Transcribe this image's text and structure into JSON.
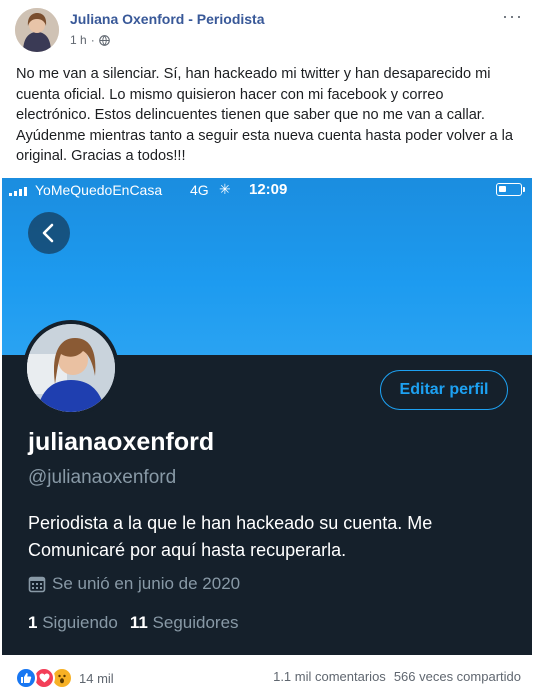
{
  "post": {
    "author": "Juliana Oxenford - Periodista",
    "time": "1 h",
    "separator": "·",
    "text": "No me van a silenciar. Sí, han hackeado mi twitter y han desaparecido mi cuenta oficial. Lo mismo quisieron hacer con mi facebook y correo electrónico. Estos delincuentes tienen que saber que no me van a callar. Ayúdenme mientras tanto a seguir esta nueva cuenta hasta poder volver a la original. Gracias a todos!!!",
    "more_icon": "···"
  },
  "phone": {
    "carrier": "YoMeQuedoEnCasa",
    "network": "4G",
    "spinner": "✳",
    "time": "12:09",
    "battery_level": 0.35
  },
  "profile": {
    "display_name": "julianaoxenford",
    "handle": "@julianaoxenford",
    "edit_button": "Editar perfil",
    "bio": "Periodista a la que le han hackeado su cuenta. Me Comunicaré por aquí hasta recuperarla.",
    "joined": "Se unió en junio de 2020",
    "following_count": "1",
    "following_label": "Siguiendo",
    "followers_count": "11",
    "followers_label": "Seguidores"
  },
  "footer": {
    "reactions_count": "14 mil",
    "comments": "1.1 mil comentarios",
    "shares": "566 veces compartido"
  },
  "colors": {
    "fb_link": "#385898",
    "twitter_blue": "#1da1f2",
    "twitter_dark_bg": "#15202b",
    "twitter_secondary": "#8899a6"
  }
}
